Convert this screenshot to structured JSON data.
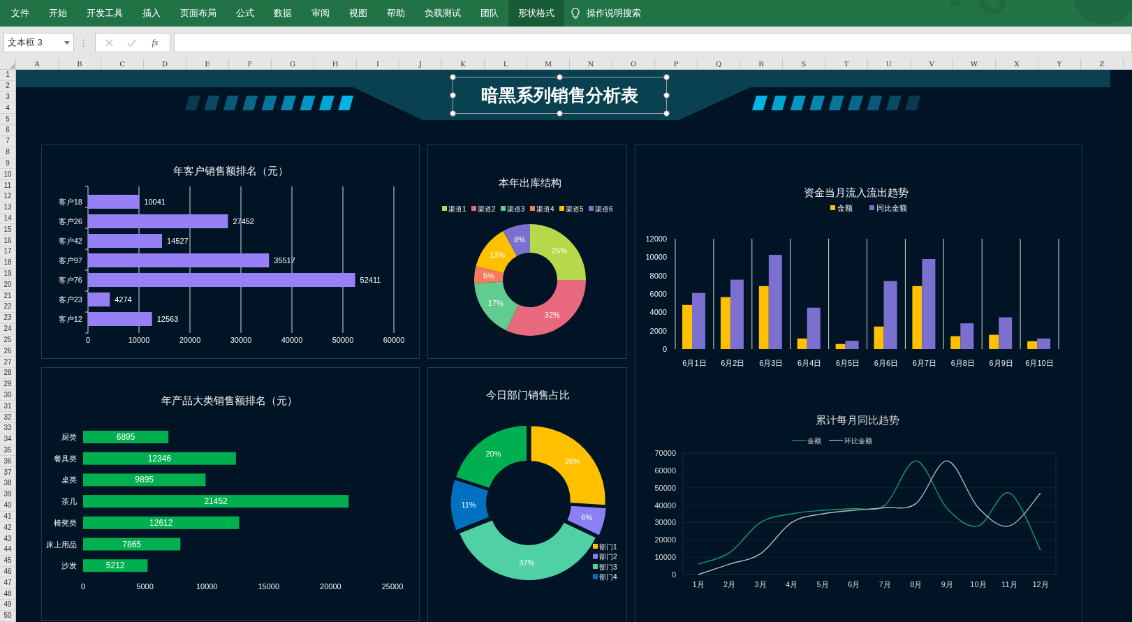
{
  "ribbon": {
    "tabs": [
      {
        "label": "文件",
        "selected": false
      },
      {
        "label": "开始",
        "selected": false
      },
      {
        "label": "开发工具",
        "selected": false
      },
      {
        "label": "插入",
        "selected": false
      },
      {
        "label": "页面布局",
        "selected": false
      },
      {
        "label": "公式",
        "selected": false
      },
      {
        "label": "数据",
        "selected": false
      },
      {
        "label": "审阅",
        "selected": false
      },
      {
        "label": "视图",
        "selected": false
      },
      {
        "label": "帮助",
        "selected": false
      },
      {
        "label": "负载测试",
        "selected": false
      },
      {
        "label": "团队",
        "selected": false
      },
      {
        "label": "形状格式",
        "selected": true
      }
    ],
    "search": "操作说明搜索"
  },
  "formula_bar": {
    "name_box": "文本框 3",
    "function_button": "fx"
  },
  "sheet": {
    "columns": [
      "A",
      "B",
      "C",
      "D",
      "E",
      "F",
      "G",
      "H",
      "I",
      "J",
      "K",
      "L",
      "M",
      "N",
      "O",
      "P",
      "Q",
      "R",
      "S",
      "T",
      "U",
      "V",
      "W",
      "X",
      "Y",
      "Z"
    ],
    "rows": [
      "1",
      "2",
      "3",
      "4",
      "5",
      "6",
      "7",
      "8",
      "9",
      "10",
      "11",
      "12",
      "13",
      "14",
      "15",
      "16",
      "17",
      "18",
      "19",
      "20",
      "21",
      "22",
      "23",
      "24",
      "25",
      "26",
      "27",
      "28",
      "29",
      "30",
      "31",
      "32",
      "33",
      "34",
      "35",
      "36",
      "37",
      "38",
      "39",
      "40",
      "41",
      "42",
      "43",
      "44",
      "45",
      "46",
      "47",
      "48",
      "49",
      "50"
    ]
  },
  "dashboard": {
    "title": "暗黑系列销售分析表",
    "panels": [
      {
        "charts": [
          {
            "chart_data": {
              "type": "bar",
              "orientation": "horizontal",
              "title": "年客户销售额排名（元）",
              "categories": [
                "客户18",
                "客户26",
                "客户42",
                "客户97",
                "客户76",
                "客户23",
                "客户12"
              ],
              "series": [
                {
                  "color": "#9580f5",
                  "values": [
                    10041,
                    27452,
                    14527,
                    35517,
                    52411,
                    4274,
                    12563
                  ]
                }
              ],
              "xlim": [
                0,
                60000
              ],
              "xticks": [
                0,
                10000,
                20000,
                30000,
                40000,
                50000,
                60000
              ],
              "grid": true,
              "data_labels": true
            }
          }
        ]
      },
      {
        "charts": [
          {
            "chart_data": {
              "type": "donut",
              "title": "本年出库结构",
              "categories": [
                "渠道1",
                "渠道2",
                "渠道3",
                "渠道4",
                "渠道5",
                "渠道6"
              ],
              "values": [
                25,
                32,
                17,
                5,
                13,
                8
              ],
              "colors": [
                "#b5d94a",
                "#e8697d",
                "#62cc90",
                "#f47c5c",
                "#ffc000",
                "#7b6fd0"
              ],
              "value_labels": [
                "25%",
                "32%",
                "17%",
                "5%",
                "13%",
                "8%"
              ],
              "legend": "top"
            }
          }
        ]
      },
      {
        "charts": [
          {
            "chart_data": {
              "type": "bar",
              "orientation": "vertical",
              "title": "资金当月流入流出趋势",
              "categories": [
                "6月1日",
                "6月2日",
                "6月3日",
                "6月4日",
                "6月5日",
                "6月6日",
                "6月7日",
                "6月8日",
                "6月9日",
                "6月10日"
              ],
              "series": [
                {
                  "name": "金额",
                  "color": "#ffc000",
                  "values": [
                    4800,
                    5650,
                    6850,
                    1150,
                    550,
                    2450,
                    6850,
                    1400,
                    1550,
                    850
                  ]
                },
                {
                  "name": "同比金额",
                  "color": "#7b6fd0",
                  "values": [
                    6100,
                    7550,
                    10250,
                    4500,
                    900,
                    7400,
                    9800,
                    2800,
                    3450,
                    1150
                  ]
                }
              ],
              "ylim": [
                0,
                12000
              ],
              "yticks": [
                0,
                2000,
                4000,
                6000,
                8000,
                10000,
                12000
              ],
              "grid": true,
              "legend": "top"
            }
          },
          {
            "chart_data": {
              "type": "line",
              "title": "累计每月同比趋势",
              "x": [
                "1月",
                "2月",
                "3月",
                "4月",
                "5月",
                "6月",
                "7月",
                "8月",
                "9月",
                "10月",
                "11月",
                "12月"
              ],
              "series": [
                {
                  "name": "金额",
                  "color": "#0f9d6e",
                  "values": [
                    6000,
                    12500,
                    30000,
                    35000,
                    37000,
                    38000,
                    40000,
                    65500,
                    38000,
                    28000,
                    47000,
                    14000
                  ]
                },
                {
                  "name": "环比金额",
                  "color": "#b4bab4",
                  "values": [
                    0,
                    6000,
                    12000,
                    30000,
                    35000,
                    37000,
                    38500,
                    41000,
                    65500,
                    38500,
                    28000,
                    47000
                  ]
                }
              ],
              "ylim": [
                0,
                70000
              ],
              "yticks": [
                0,
                10000,
                20000,
                30000,
                40000,
                50000,
                60000,
                70000
              ],
              "grid": true,
              "legend": "top"
            }
          }
        ]
      },
      {
        "charts": [
          {
            "chart_data": {
              "type": "bar",
              "orientation": "horizontal",
              "title": "年产品大类销售额排名（元）",
              "categories": [
                "厨类",
                "餐具类",
                "桌类",
                "茶几",
                "椅凳类",
                "床上用品",
                "沙发"
              ],
              "series": [
                {
                  "color": "#00b050",
                  "values": [
                    6895,
                    12346,
                    9895,
                    21452,
                    12612,
                    7865,
                    5212
                  ]
                }
              ],
              "xlim": [
                0,
                25000
              ],
              "xticks": [
                0,
                5000,
                10000,
                15000,
                20000,
                25000
              ],
              "data_labels": true
            }
          }
        ]
      },
      {
        "charts": [
          {
            "chart_data": {
              "type": "donut",
              "title": "今日部门销售占比",
              "categories": [
                "部门1",
                "部门2",
                "部门3",
                "部门4",
                null
              ],
              "values": [
                26,
                6,
                37,
                11,
                20
              ],
              "colors": [
                "#ffc000",
                "#8b7ff5",
                "#4fd1a5",
                "#0070c0",
                "#00b050"
              ],
              "value_labels": [
                "26%",
                "6%",
                "37%",
                "11%",
                "20%"
              ],
              "legend": "right"
            }
          }
        ]
      }
    ]
  }
}
